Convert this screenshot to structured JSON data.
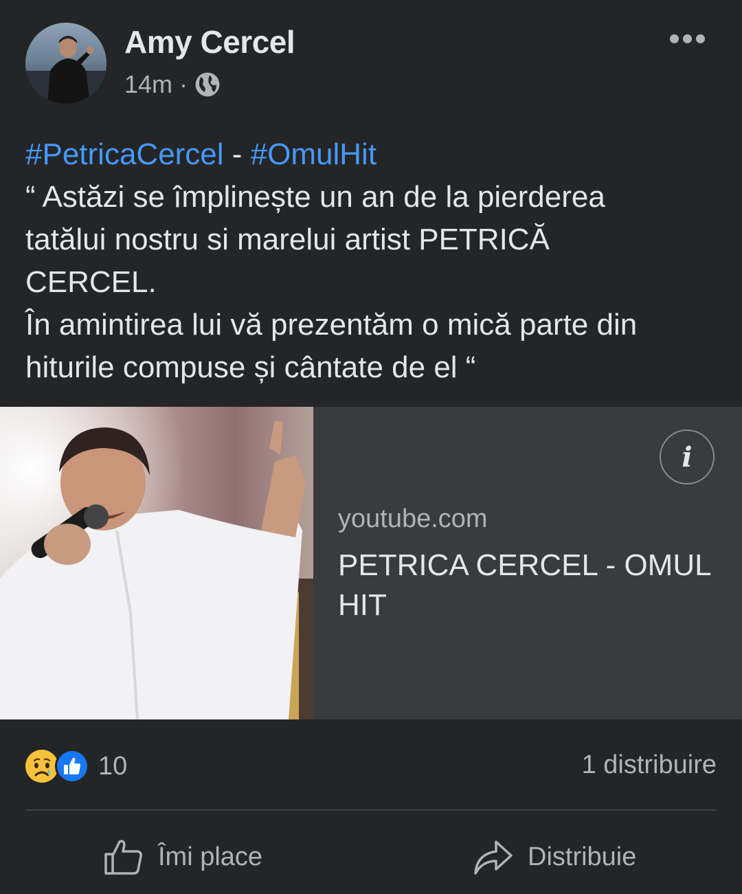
{
  "post": {
    "author": "Amy Cercel",
    "time": "14m",
    "separator": "·",
    "text_lines": [
      "“ Astăzi se împlinește un an de la pierderea",
      "tatălui nostru si marelui artist PETRICĂ",
      "CERCEL.",
      "În amintirea lui vă prezentăm o mică parte din",
      "hiturile compuse și cântate de el “"
    ],
    "hashtags": [
      "#PetricaCercel",
      "#OmulHit"
    ],
    "hashtag_separator": " - "
  },
  "link_preview": {
    "domain": "youtube.com",
    "title": "PETRICA CERCEL - OMUL HIT",
    "info_label": "i"
  },
  "engagement": {
    "reaction_icons": [
      "sad-icon",
      "like-icon"
    ],
    "reaction_count": "10",
    "shares": "1 distribuire"
  },
  "actions": {
    "like_label": "Îmi place",
    "share_label": "Distribuie"
  },
  "colors": {
    "background": "#242526",
    "card": "#3a3b3c",
    "hashtag": "#4599ff",
    "text_primary": "#e4e6eb",
    "text_secondary": "#b0b3b8"
  }
}
